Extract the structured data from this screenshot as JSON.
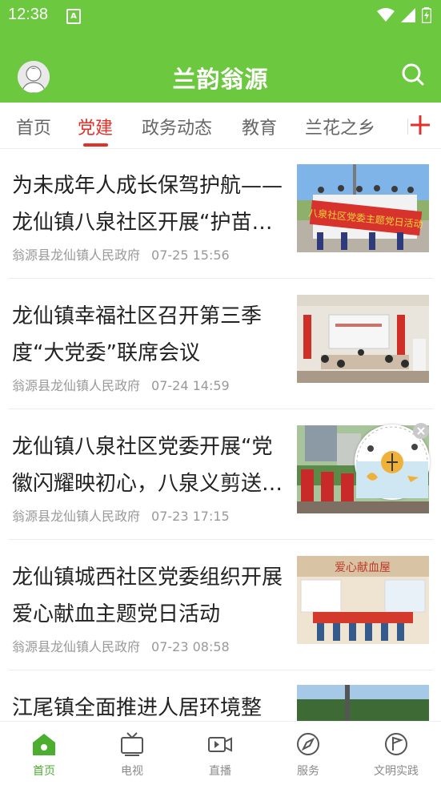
{
  "status": {
    "time": "12:38",
    "notif_glyph": "A"
  },
  "app": {
    "title": "兰韵翁源"
  },
  "tabs": [
    {
      "label": "首页"
    },
    {
      "label": "党建"
    },
    {
      "label": "政务动态"
    },
    {
      "label": "教育"
    },
    {
      "label": "兰花之乡"
    }
  ],
  "active_tab": "党建",
  "news": [
    {
      "title": "为未成年人成长保驾护航——龙仙镇八泉社区开展“护苗…",
      "source": "翁源县龙仙镇人民政府",
      "time": "07-25 15:56",
      "banner": "八泉社区党委主题党日活动"
    },
    {
      "title": "龙仙镇幸福社区召开第三季度“大党委”联席会议",
      "source": "翁源县龙仙镇人民政府",
      "time": "07-24 14:59"
    },
    {
      "title": "龙仙镇八泉社区党委开展“党徽闪耀映初心，八泉义剪送…",
      "source": "翁源县龙仙镇人民政府",
      "time": "07-23 17:15"
    },
    {
      "title": "龙仙镇城西社区党委组织开展爱心献血主题党日活动",
      "source": "翁源县龙仙镇人民政府",
      "time": "07-23 08:58",
      "sign": "爱心献血屋"
    },
    {
      "title": "江尾镇全面推进人居环境整",
      "source": "",
      "time": ""
    }
  ],
  "bottom_nav": [
    {
      "label": "首页",
      "icon": "home-icon",
      "active": true
    },
    {
      "label": "电视",
      "icon": "tv-icon",
      "active": false
    },
    {
      "label": "直播",
      "icon": "live-icon",
      "active": false
    },
    {
      "label": "服务",
      "icon": "compass-icon",
      "active": false
    },
    {
      "label": "文明实践",
      "icon": "flag-circle-icon",
      "active": false
    }
  ],
  "colors": {
    "brand_green": "#6cc83f",
    "accent_red": "#e0312b",
    "nav_active": "#4bae2e"
  }
}
